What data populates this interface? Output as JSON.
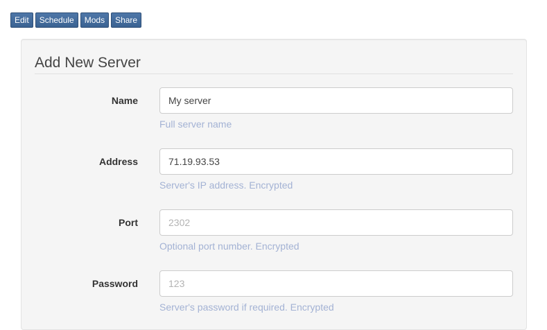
{
  "toolbar": {
    "buttons": [
      "Edit",
      "Schedule",
      "Mods",
      "Share"
    ]
  },
  "form": {
    "title": "Add New Server",
    "fields": [
      {
        "label": "Name",
        "value": "My server",
        "placeholder": "",
        "help": "Full server name"
      },
      {
        "label": "Address",
        "value": "71.19.93.53",
        "placeholder": "",
        "help": "Server's IP address. Encrypted"
      },
      {
        "label": "Port",
        "value": "",
        "placeholder": "2302",
        "help": "Optional port number. Encrypted"
      },
      {
        "label": "Password",
        "value": "",
        "placeholder": "123",
        "help": "Server's password if required. Encrypted"
      }
    ]
  },
  "colors": {
    "button_bg": "#4a6fa0",
    "help_text": "#a3b2d4",
    "panel_bg": "#f5f5f5"
  }
}
